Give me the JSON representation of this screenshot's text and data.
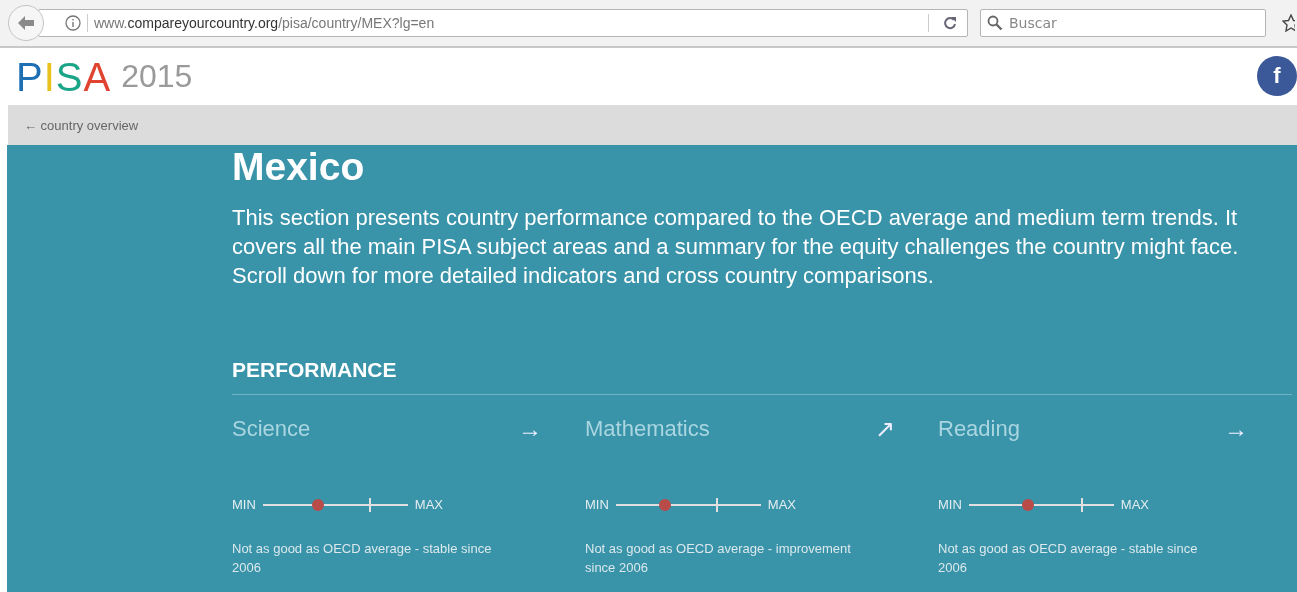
{
  "browser": {
    "url": "www.**compareyourcountry.org**/pisa/country/MEX?lg=en",
    "search": {
      "placeholder": "Buscar"
    }
  },
  "header": {
    "logo": "PISA",
    "year": "2015",
    "social": "f"
  },
  "nav": {
    "back_link": "← country overview"
  },
  "country": {
    "title": "Mexico",
    "intro": "This section presents country performance compared to the OECD average and medium term trends. It covers all the main PISA subject areas and a summary for the equity challenges the country might face. Scroll down for more detailed indicators and cross country comparisons."
  },
  "performance": {
    "heading": "PERFORMANCE",
    "subjects": [
      {
        "name": "Science",
        "trend": "→",
        "min_label": "MIN",
        "max_label": "MAX",
        "level": 0.38,
        "oecd_marker": {
          "level": 0.74
        },
        "summary": "Not as good as OECD average - stable since 2006"
      },
      {
        "name": "Mathematics",
        "trend": "↗",
        "min_label": "MIN",
        "max_label": "MAX",
        "level": 0.34,
        "oecd_marker": {
          "level": 0.7
        },
        "summary": "Not as good as OECD average - improvement since 2006"
      },
      {
        "name": "Reading",
        "trend": "→",
        "min_label": "MIN",
        "max_label": "MAX",
        "level": 0.41,
        "oecd_marker": {
          "level": 0.78
        },
        "summary": "Not as good as OECD average - stable since 2006"
      }
    ]
  }
}
